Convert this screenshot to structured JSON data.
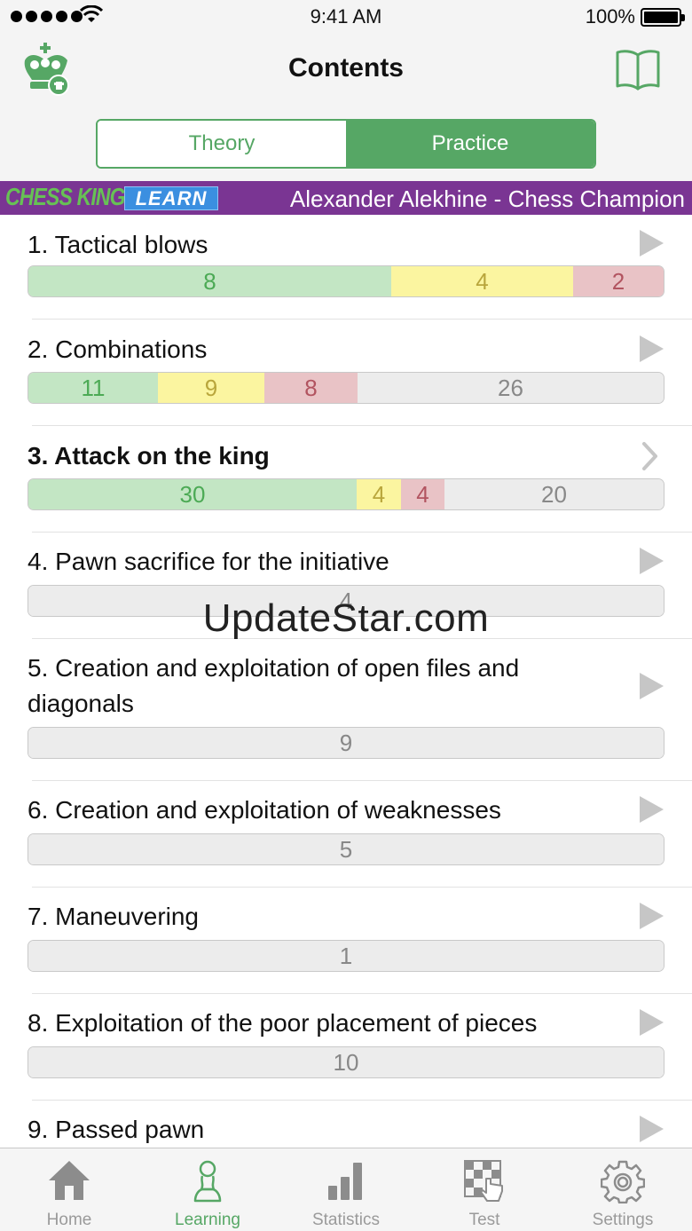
{
  "status": {
    "time": "9:41 AM",
    "battery": "100%"
  },
  "nav": {
    "title": "Contents"
  },
  "segments": {
    "theory": "Theory",
    "practice": "Practice"
  },
  "banner": {
    "brand": "CHESS KING",
    "badge": "LEARN",
    "title": "Alexander Alekhine - Chess Champion"
  },
  "items": [
    {
      "title": "1. Tactical blows",
      "green": "8",
      "yellow": "4",
      "red": "2"
    },
    {
      "title": "2. Combinations",
      "green": "11",
      "yellow": "9",
      "red": "8",
      "rest": "26"
    },
    {
      "title": "3. Attack on the king",
      "green": "30",
      "yellow": "4",
      "red": "4",
      "rest": "20"
    },
    {
      "title": "4. Pawn sacrifice for the initiative",
      "rest": "4"
    },
    {
      "title": "5. Creation and exploitation of open files and diagonals",
      "rest": "9"
    },
    {
      "title": "6. Creation and exploitation of weaknesses",
      "rest": "5"
    },
    {
      "title": "7. Maneuvering",
      "rest": "1"
    },
    {
      "title": "8. Exploitation of the poor placement of pieces",
      "rest": "10"
    },
    {
      "title": "9. Passed pawn"
    }
  ],
  "watermark": "UpdateStar.com",
  "tabs": {
    "home": "Home",
    "learning": "Learning",
    "statistics": "Statistics",
    "test": "Test",
    "settings": "Settings"
  },
  "icons": {
    "logo": "chess-king-logo-icon",
    "book": "book-icon",
    "play": "play-arrow-icon",
    "chevron": "chevron-right-icon",
    "home": "home-icon",
    "learning": "pawn-icon",
    "statistics": "bar-chart-icon",
    "test": "chessboard-hand-icon",
    "settings": "gear-icon"
  },
  "colors": {
    "accent": "#56a765",
    "banner": "#7a3593",
    "green": "#c3e6c4",
    "yellow": "#fbf5a0",
    "red": "#e9c3c6",
    "empty": "#ececec"
  }
}
